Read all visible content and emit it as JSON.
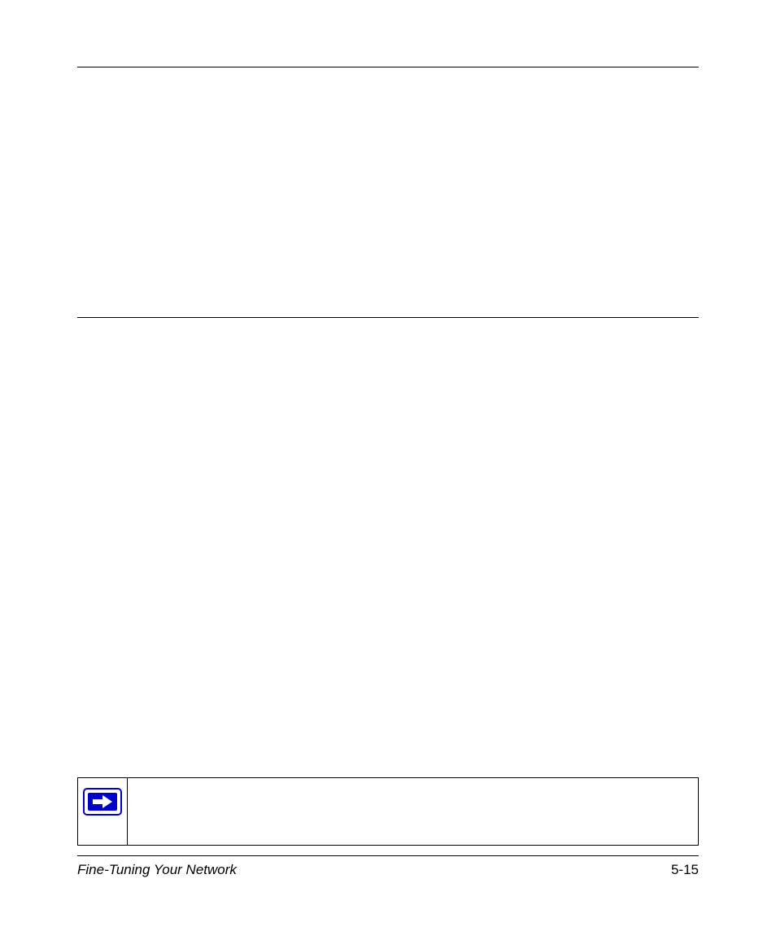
{
  "footer": {
    "left": "Fine-Tuning Your Network",
    "right": "5-15"
  }
}
